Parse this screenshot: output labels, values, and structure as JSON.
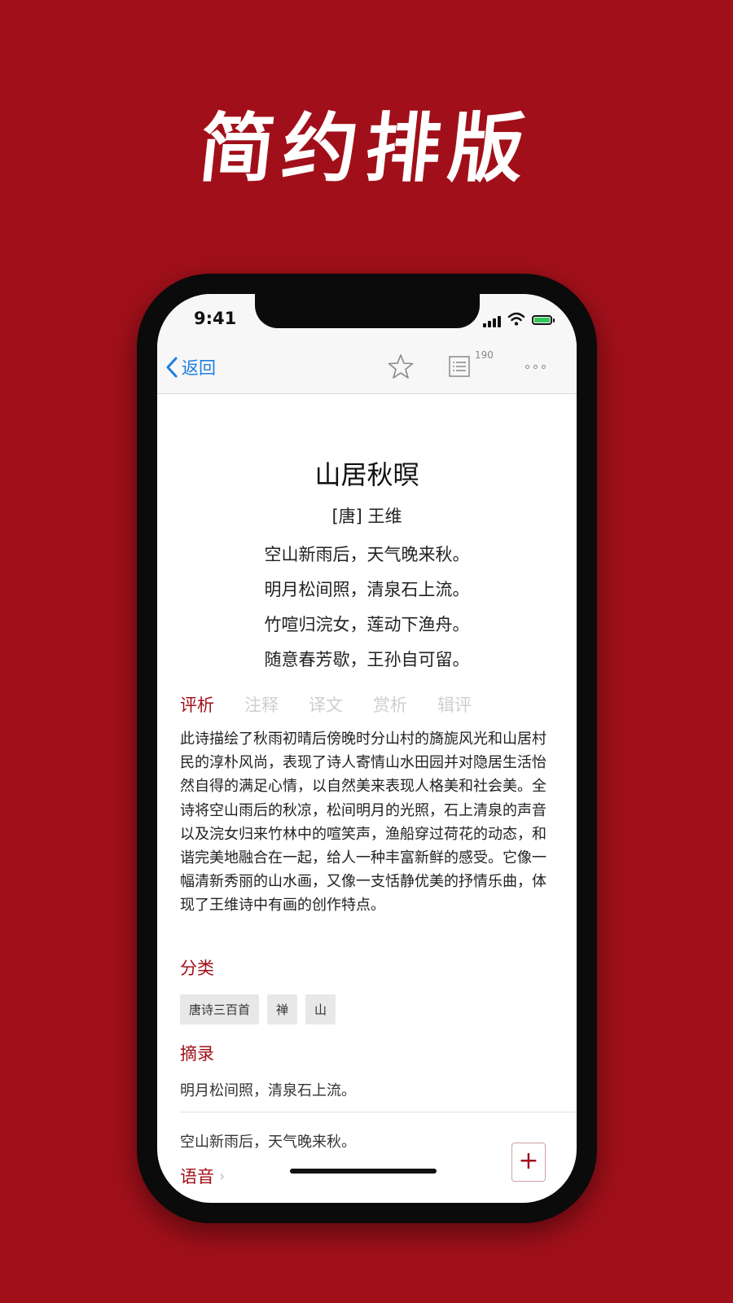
{
  "headline": "简约排版",
  "status_bar": {
    "time": "9:41"
  },
  "nav": {
    "back_label": "返回",
    "list_count": "190"
  },
  "poem": {
    "title": "山居秋暝",
    "author": "[唐] 王维",
    "lines": [
      "空山新雨后，天气晚来秋。",
      "明月松间照，清泉石上流。",
      "竹喧归浣女，莲动下渔舟。",
      "随意春芳歇，王孙自可留。"
    ]
  },
  "tabs": [
    "评析",
    "注释",
    "译文",
    "赏析",
    "辑评"
  ],
  "active_tab": "评析",
  "analysis": "此诗描绘了秋雨初晴后傍晚时分山村的旖旎风光和山居村民的淳朴风尚，表现了诗人寄情山水田园并对隐居生活怡然自得的满足心情，以自然美来表现人格美和社会美。全诗将空山雨后的秋凉，松间明月的光照，石上清泉的声音以及浣女归来竹林中的喧笑声，渔船穿过荷花的动态，和谐完美地融合在一起，给人一种丰富新鲜的感受。它像一幅清新秀丽的山水画，又像一支恬静优美的抒情乐曲，体现了王维诗中有画的创作特点。",
  "category": {
    "title": "分类",
    "tags": [
      "唐诗三百首",
      "禅",
      "山"
    ]
  },
  "excerpts": {
    "title": "摘录",
    "items": [
      "明月松间照，清泉石上流。",
      "空山新雨后，天气晚来秋。"
    ]
  },
  "voice": {
    "label": "语音"
  },
  "add_button": "+",
  "colors": {
    "brand_red": "#a1101a",
    "link_blue": "#1d7fe0",
    "tag_bg": "#e8e8e8"
  },
  "icons": [
    "chevron-left-icon",
    "star-icon",
    "list-icon",
    "more-icon",
    "signal-icon",
    "wifi-icon",
    "battery-icon",
    "plus-icon"
  ]
}
